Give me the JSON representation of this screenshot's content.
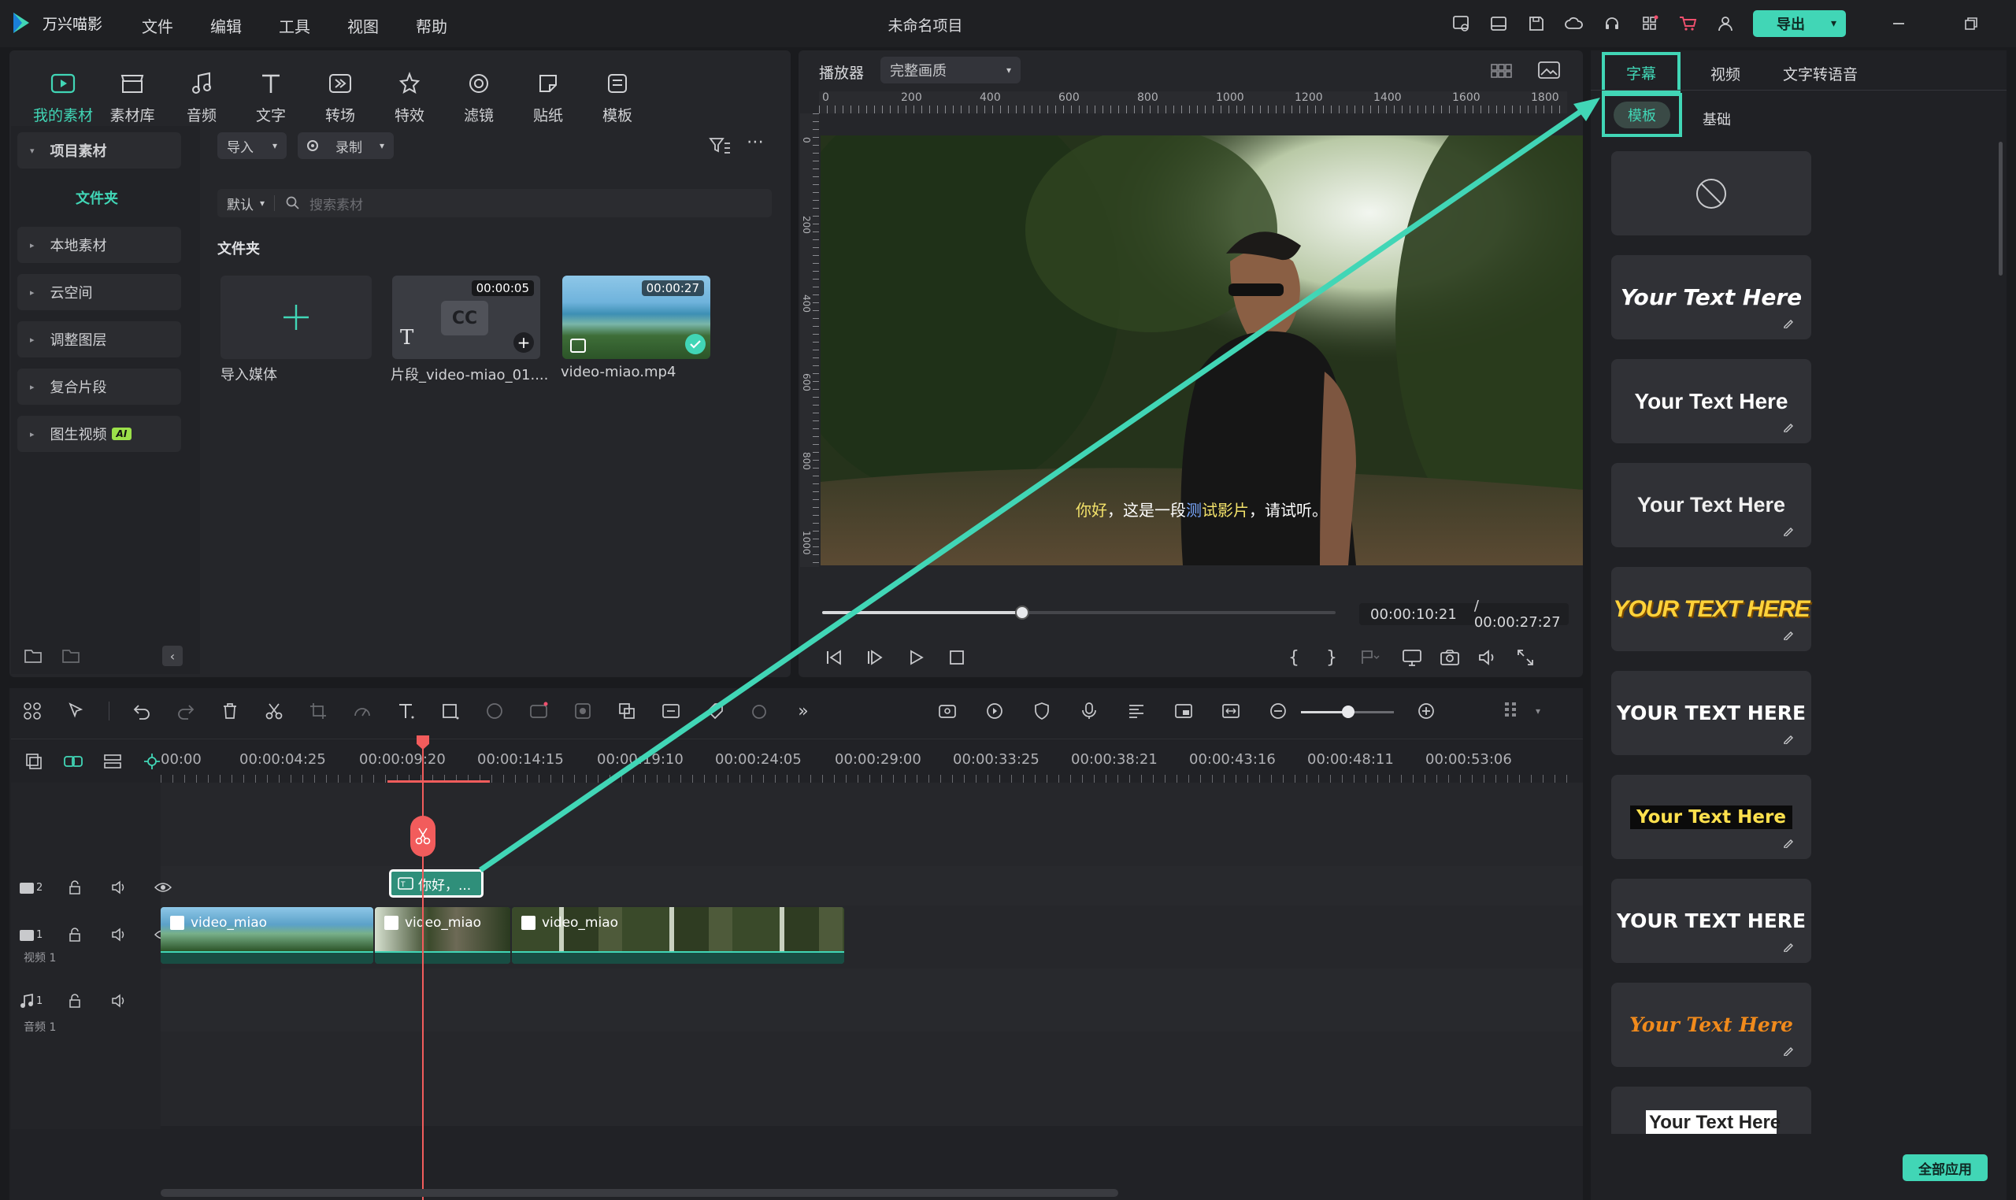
{
  "app": {
    "name": "万兴喵影",
    "project_title": "未命名项目",
    "export_label": "导出"
  },
  "menu": [
    "文件",
    "编辑",
    "工具",
    "视图",
    "帮助"
  ],
  "title_icons": [
    "message-icon",
    "layout-icon",
    "save-icon",
    "cloud-icon",
    "headset-icon",
    "apps-icon",
    "cart-icon",
    "user-icon"
  ],
  "tools": [
    {
      "label": "我的素材",
      "icon": "media-icon"
    },
    {
      "label": "素材库",
      "icon": "store-icon"
    },
    {
      "label": "音频",
      "icon": "music-icon"
    },
    {
      "label": "文字",
      "icon": "text-icon"
    },
    {
      "label": "转场",
      "icon": "transition-icon"
    },
    {
      "label": "特效",
      "icon": "effect-icon"
    },
    {
      "label": "滤镜",
      "icon": "filter-icon"
    },
    {
      "label": "贴纸",
      "icon": "sticker-icon"
    },
    {
      "label": "模板",
      "icon": "template-icon"
    }
  ],
  "sidebar": {
    "items": [
      {
        "label": "项目素材",
        "expanded": true
      },
      {
        "label": "文件夹",
        "child": true
      },
      {
        "label": "本地素材"
      },
      {
        "label": "云空间"
      },
      {
        "label": "调整图层"
      },
      {
        "label": "复合片段"
      },
      {
        "label": "图生视频",
        "badge": "AI"
      }
    ]
  },
  "media": {
    "import_label": "导入",
    "record_label": "录制",
    "sort_label": "默认",
    "search_placeholder": "搜索素材",
    "folder_heading": "文件夹",
    "items": [
      {
        "label": "导入媒体",
        "type": "import"
      },
      {
        "label": "片段_video-miao_01....",
        "duration": "00:00:05",
        "type": "caption"
      },
      {
        "label": "video-miao.mp4",
        "duration": "00:00:27",
        "type": "video"
      }
    ]
  },
  "player": {
    "label": "播放器",
    "quality": "完整画质",
    "ruler_h": [
      "0",
      "200",
      "400",
      "600",
      "800",
      "1000",
      "1200",
      "1400",
      "1600",
      "1800"
    ],
    "ruler_v": [
      "0",
      "200",
      "400",
      "600",
      "800",
      "1000"
    ],
    "subtitle_parts": [
      {
        "text": "你好",
        "color": "#f3e26a"
      },
      {
        "text": "，这是一段",
        "color": "#ffffff"
      },
      {
        "text": "测",
        "color": "#7aa8ff"
      },
      {
        "text": "试影片",
        "color": "#f3e26a"
      },
      {
        "text": "，请试听。",
        "color": "#ffffff"
      }
    ],
    "current_time": "00:00:10:21",
    "total_time": "/ 00:00:27:27",
    "progress": 0.39
  },
  "timeline": {
    "ruler": [
      "00:00",
      "00:00:04:25",
      "00:00:09:20",
      "00:00:14:15",
      "00:00:19:10",
      "00:00:24:05",
      "00:00:29:00",
      "00:00:33:25",
      "00:00:38:21",
      "00:00:43:16",
      "00:00:48:11",
      "00:00:53:06"
    ],
    "tracks": [
      {
        "id": "2",
        "label": ""
      },
      {
        "id": "1",
        "label": "视频 1"
      },
      {
        "id": "1",
        "label": "音频 1"
      }
    ],
    "subtitle_clip": "你好，...",
    "video_clips": [
      "video_miao",
      "video_miao",
      "video_miao"
    ]
  },
  "right_panel": {
    "tabs": [
      "字幕",
      "视频",
      "文字转语音"
    ],
    "subtabs": [
      "模板",
      "基础"
    ],
    "templates": [
      {
        "text": "Your Text Here",
        "style": "italic-white-orange"
      },
      {
        "text": "Your Text Here",
        "style": "white-yellow"
      },
      {
        "text": "Your Text Here",
        "style": "white-yellow2"
      },
      {
        "text": "YOUR TEXT HERE",
        "style": "yellow-outline"
      },
      {
        "text": "YOUR TEXT HERE",
        "style": "white-green"
      },
      {
        "text": "Your Text Here",
        "style": "black-box"
      },
      {
        "text": "YOUR TEXT HERE",
        "style": "white-red"
      },
      {
        "text": "Your Text Here",
        "style": "orange-italic"
      },
      {
        "text": "Your Text Here",
        "style": "white-box"
      }
    ],
    "apply_all": "全部应用"
  },
  "colors": {
    "accent": "#41d6b6",
    "playhead": "#f25c5c",
    "background": "#1a1b1e",
    "panel": "#25262a"
  }
}
